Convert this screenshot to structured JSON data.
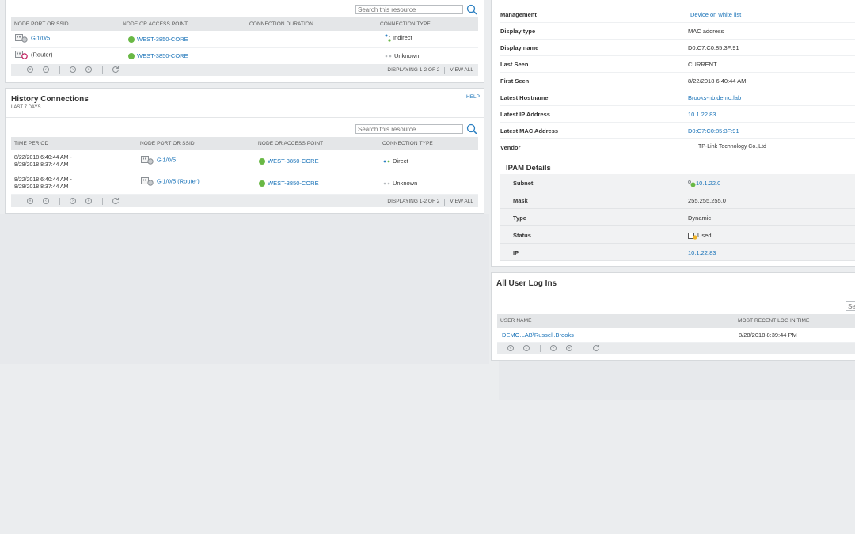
{
  "current_connections": {
    "search_placeholder": "Search this resource",
    "columns": [
      "NODE PORT OR SSID",
      "NODE OR ACCESS POINT",
      "CONNECTION DURATION",
      "CONNECTION TYPE"
    ],
    "rows": [
      {
        "port": "Gi1/0/5",
        "node": "WEST-3850-CORE",
        "duration": "",
        "type": "Indirect"
      },
      {
        "port": "(Router)",
        "node": "WEST-3850-CORE",
        "duration": "",
        "type": "Unknown"
      }
    ],
    "pager": {
      "displaying": "DISPLAYING 1-2 OF 2",
      "view_all": "VIEW ALL"
    }
  },
  "history_connections": {
    "title": "History Connections",
    "subtitle": "LAST 7 DAYS",
    "help": "HELP",
    "search_placeholder": "Search this resource",
    "columns": [
      "TIME PERIOD",
      "NODE PORT OR SSID",
      "NODE OR ACCESS POINT",
      "CONNECTION TYPE"
    ],
    "rows": [
      {
        "period_start": "8/22/2018 6:40:44 AM -",
        "period_end": "8/28/2018 8:37:44 AM",
        "port": "Gi1/0/5",
        "node": "WEST-3850-CORE",
        "type": "Direct"
      },
      {
        "period_start": "8/22/2018 6:40:44 AM -",
        "period_end": "8/28/2018 8:37:44 AM",
        "port": "Gi1/0/5 (Router)",
        "node": "WEST-3850-CORE",
        "type": "Unknown"
      }
    ],
    "pager": {
      "displaying": "DISPLAYING 1-2 OF 2",
      "view_all": "VIEW ALL"
    }
  },
  "details": {
    "rows": [
      {
        "label": "Management",
        "value": "Device on white list",
        "link": true
      },
      {
        "label": "Display type",
        "value": "MAC address",
        "link": false
      },
      {
        "label": "Display name",
        "value": "D0:C7:C0:85:3F:91",
        "link": false
      },
      {
        "label": "Last Seen",
        "value": "CURRENT",
        "link": false
      },
      {
        "label": "First Seen",
        "value": "8/22/2018 6:40:44 AM",
        "link": false
      },
      {
        "label": "Latest Hostname",
        "value": "Brooks-nb.demo.lab",
        "link": true
      },
      {
        "label": "Latest IP Address",
        "value": "10.1.22.83",
        "link": true
      },
      {
        "label": "Latest MAC Address",
        "value": "D0:C7:C0:85:3F:91",
        "link": true
      },
      {
        "label": "Vendor",
        "value": "TP-Link Technology Co.,Ltd",
        "link": false
      }
    ],
    "ipam": {
      "title": "IPAM Details",
      "rows": [
        {
          "label": "Subnet",
          "value": "10.1.22.0",
          "link": true
        },
        {
          "label": "Mask",
          "value": "255.255.255.0",
          "link": false
        },
        {
          "label": "Type",
          "value": "Dynamic",
          "link": false
        },
        {
          "label": "Status",
          "value": "Used",
          "link": false
        },
        {
          "label": "IP",
          "value": "10.1.22.83",
          "link": true
        }
      ]
    }
  },
  "user_logins": {
    "title": "All User Log Ins",
    "search_placeholder": "Sea",
    "columns": [
      "USER NAME",
      "MOST RECENT LOG IN TIME"
    ],
    "rows": [
      {
        "user": "DEMO.LAB\\Russell.Brooks",
        "time": "8/28/2018 8:39:44 PM"
      }
    ]
  },
  "colors": {
    "link": "#1a73b8",
    "status_green": "#69b845",
    "header_bg": "#e4e6e8"
  }
}
